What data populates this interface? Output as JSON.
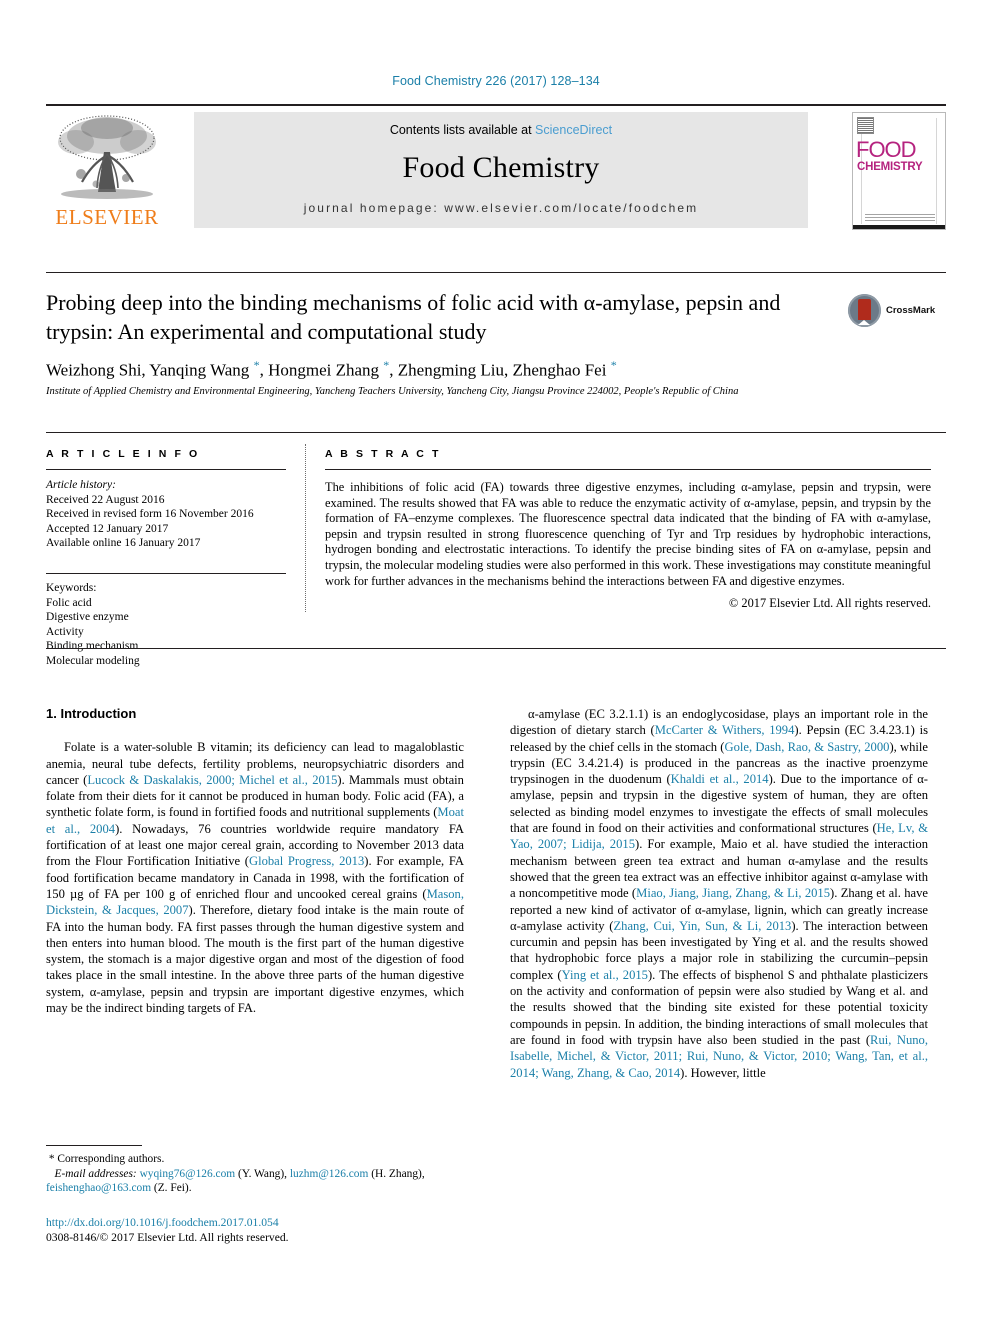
{
  "running_head": "Food Chemistry 226 (2017) 128–134",
  "masthead": {
    "contents_prefix": "Contents lists available at ",
    "sciencedirect": "ScienceDirect",
    "journal_title": "Food Chemistry",
    "homepage": "journal homepage: www.elsevier.com/locate/foodchem",
    "publisher_name": "ELSEVIER",
    "cover": {
      "line1": "FOOD",
      "line2": "CHEMISTRY",
      "accent_color": "#b5237f"
    }
  },
  "article": {
    "title": "Probing deep into the binding mechanisms of folic acid with α-amylase, pepsin and trypsin: An experimental and computational study",
    "crossmark_label": "CrossMark",
    "authors_html": "Weizhong Shi, Yanqing Wang <sup>*</sup>, Hongmei Zhang <sup>*</sup>, Zhengming Liu, Zhenghao Fei <sup>*</sup>",
    "affiliation": "Institute of Applied Chemistry and Environmental Engineering, Yancheng Teachers University, Yancheng City, Jiangsu Province 224002, People's Republic of China"
  },
  "article_info": {
    "heading": "A R T I C L E   I N F O",
    "history_label": "Article history:",
    "history": [
      "Received 22 August 2016",
      "Received in revised form 16 November 2016",
      "Accepted 12 January 2017",
      "Available online 16 January 2017"
    ],
    "keywords_label": "Keywords:",
    "keywords": [
      "Folic acid",
      "Digestive enzyme",
      "Activity",
      "Binding mechanism",
      "Molecular modeling"
    ]
  },
  "abstract": {
    "heading": "A B S T R A C T",
    "text": "The inhibitions of folic acid (FA) towards three digestive enzymes, including α-amylase, pepsin and trypsin, were examined. The results showed that FA was able to reduce the enzymatic activity of α-amylase, pepsin, and trypsin by the formation of FA–enzyme complexes. The fluorescence spectral data indicated that the binding of FA with α-amylase, pepsin and trypsin resulted in strong fluorescence quenching of Tyr and Trp residues by hydrophobic interactions, hydrogen bonding and electrostatic interactions. To identify the precise binding sites of FA on α-amylase, pepsin and trypsin, the molecular modeling studies were also performed in this work. These investigations may constitute meaningful work for further advances in the mechanisms behind the interactions between FA and digestive enzymes.",
    "rights": "© 2017 Elsevier Ltd. All rights reserved."
  },
  "body": {
    "section_heading": "1. Introduction",
    "left_paragraph_html": "Folate is a water-soluble B vitamin; its deficiency can lead to magaloblastic anemia, neural tube defects, fertility problems, neuropsychiatric disorders and cancer (<span class=\"cite\">Lucock &amp; Daskalakis, 2000; Michel et al., 2015</span>). Mammals must obtain folate from their diets for it cannot be produced in human body. Folic acid (FA), a synthetic folate form, is found in fortified foods and nutritional supplements (<span class=\"cite\">Moat et al., 2004</span>). Nowadays, 76 countries worldwide require mandatory FA fortification of at least one major cereal grain, according to November 2013 data from the Flour Fortification Initiative (<span class=\"cite\">Global Progress, 2013</span>). For example, FA food fortification became mandatory in Canada in 1998, with the fortification of 150 µg of FA per 100 g of enriched flour and uncooked cereal grains (<span class=\"cite\">Mason, Dickstein, &amp; Jacques, 2007</span>). Therefore, dietary food intake is the main route of FA into the human body. FA first passes through the human digestive system and then enters into human blood. The mouth is the first part of the human digestive system, the stomach is a major digestive organ and most of the digestion of food takes place in the small intestine. In the above three parts of the human digestive system, α-amylase, pepsin and trypsin are important digestive enzymes, which may be the indirect binding targets of FA.",
    "right_paragraph_html": "α-amylase (EC 3.2.1.1) is an endoglycosidase, plays an important role in the digestion of dietary starch (<span class=\"cite\">McCarter &amp; Withers, 1994</span>). Pepsin (EC 3.4.23.1) is released by the chief cells in the stomach (<span class=\"cite\">Gole, Dash, Rao, &amp; Sastry, 2000</span>), while trypsin (EC 3.4.21.4) is produced in the pancreas as the inactive proenzyme trypsinogen in the duodenum (<span class=\"cite\">Khaldi et al., 2014</span>). Due to the importance of α-amylase, pepsin and trypsin in the digestive system of human, they are often selected as binding model enzymes to investigate the effects of small molecules that are found in food on their activities and conformational structures (<span class=\"cite\">He, Lv, &amp; Yao, 2007; Lidija, 2015</span>). For example, Maio et al. have studied the interaction mechanism between green tea extract and human α-amylase and the results showed that the green tea extract was an effective inhibitor against α-amylase with a noncompetitive mode (<span class=\"cite\">Miao, Jiang, Jiang, Zhang, &amp; Li, 2015</span>). Zhang et al. have reported a new kind of activator of α-amylase, lignin, which can greatly increase α-amylase activity (<span class=\"cite\">Zhang, Cui, Yin, Sun, &amp; Li, 2013</span>). The interaction between curcumin and pepsin has been investigated by Ying et al. and the results showed that hydrophobic force plays a major role in stabilizing the curcumin–pepsin complex (<span class=\"cite\">Ying et al., 2015</span>). The effects of bisphenol S and phthalate plasticizers on the activity and conformation of pepsin were also studied by Wang et al. and the results showed that the binding site existed for these potential toxicity compounds in pepsin. In addition, the binding interactions of small molecules that are found in food with trypsin have also been studied in the past (<span class=\"cite\">Rui, Nuno, Isabelle, Michel, &amp; Victor, 2011; Rui, Nuno, &amp; Victor, 2010; Wang, Tan, et al., 2014; Wang, Zhang, &amp; Cao, 2014</span>). However, little"
  },
  "footnotes": {
    "corresponding": "Corresponding authors.",
    "email_label": "E-mail addresses:",
    "email_html": " <span class=\"mail\">wyqing76@126.com</span> (Y. Wang), <span class=\"mail\">luzhm@126.com</span> (H. Zhang), <span class=\"mail\">feishenghao@163.com</span> (Z. Fei).",
    "doi": "http://dx.doi.org/10.1016/j.foodchem.2017.01.054",
    "issn_line": "0308-8146/© 2017 Elsevier Ltd. All rights reserved."
  }
}
